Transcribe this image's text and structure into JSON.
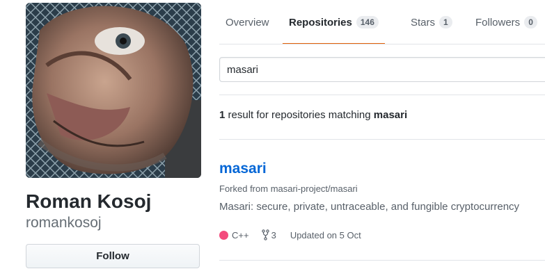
{
  "profile": {
    "full_name": "Roman Kosoj",
    "username": "romankosoj",
    "follow_label": "Follow"
  },
  "tabs": [
    {
      "label": "Overview"
    },
    {
      "label": "Repositories",
      "count": "146",
      "selected": true
    },
    {
      "label": "Stars",
      "count": "1"
    },
    {
      "label": "Followers",
      "count": "0"
    }
  ],
  "search": {
    "value": "masari"
  },
  "results": {
    "count": "1",
    "text": " result for repositories matching ",
    "query": "masari"
  },
  "repo": {
    "name": "masari",
    "forked_prefix": "Forked from ",
    "forked_from": "masari-project/masari",
    "description": "Masari: secure, private, untraceable, and fungible cryptocurrency",
    "language": "C++",
    "language_color": "#f34b7d",
    "forks": "3",
    "updated": "Updated on 5 Oct"
  },
  "colors": {
    "accent_tab": "#e36209",
    "link": "#0366d6"
  }
}
